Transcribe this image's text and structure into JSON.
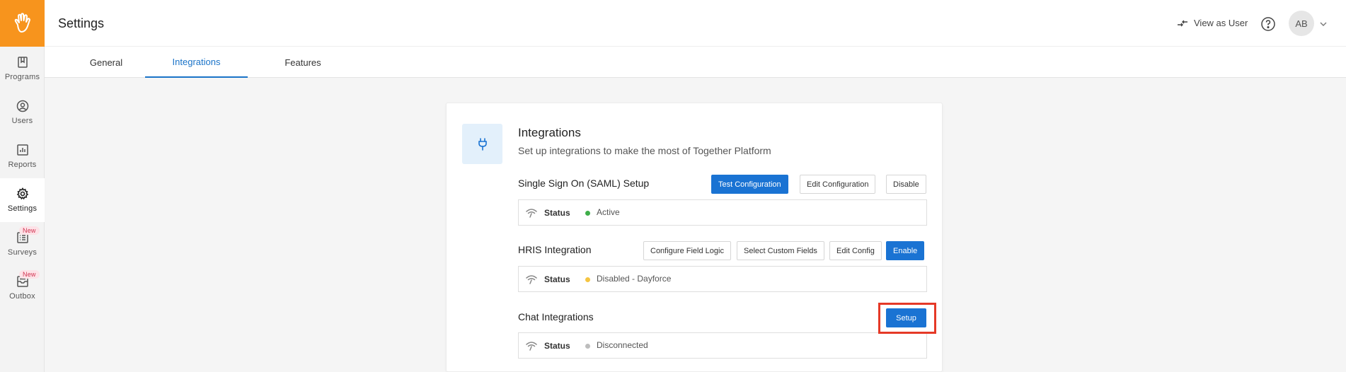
{
  "header": {
    "title": "Settings",
    "view_as_user": "View as User",
    "avatar_initials": "AB"
  },
  "sidebar": {
    "items": [
      {
        "label": "Programs",
        "icon": "book-icon"
      },
      {
        "label": "Users",
        "icon": "user-circle-icon"
      },
      {
        "label": "Reports",
        "icon": "chart-icon"
      },
      {
        "label": "Settings",
        "icon": "gear-icon",
        "active": true
      },
      {
        "label": "Surveys",
        "icon": "survey-icon",
        "badge": "New"
      },
      {
        "label": "Outbox",
        "icon": "outbox-icon",
        "badge": "New"
      }
    ]
  },
  "tabs": [
    {
      "label": "General"
    },
    {
      "label": "Integrations",
      "active": true
    },
    {
      "label": "Features"
    }
  ],
  "card": {
    "title": "Integrations",
    "subtitle": "Set up integrations to make the most of Together Platform",
    "saml": {
      "title": "Single Sign On (SAML) Setup",
      "buttons": [
        "Test Configuration",
        "Edit Configuration",
        "Disable"
      ],
      "status_label": "Status",
      "status_value": "Active",
      "status_color": "#3fae4a"
    },
    "hris": {
      "title": "HRIS Integration",
      "buttons": [
        "Configure Field Logic",
        "Select Custom Fields",
        "Edit Config",
        "Enable"
      ],
      "status_label": "Status",
      "status_value": "Disabled - Dayforce",
      "status_color": "#f5c542"
    },
    "chat": {
      "title": "Chat Integrations",
      "button": "Setup",
      "status_label": "Status",
      "status_value": "Disconnected",
      "status_color": "#bdbdbd"
    }
  },
  "colors": {
    "brand": "#f7941d",
    "accent": "#1a73d3",
    "highlight": "#e53927"
  }
}
